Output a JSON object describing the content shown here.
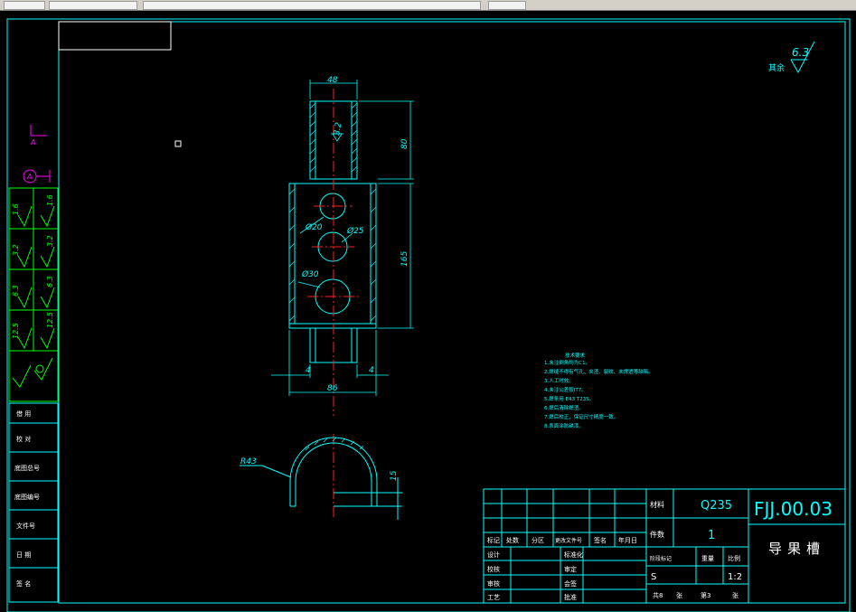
{
  "colors": {
    "background": "#000000",
    "border": "#00ffff",
    "outline": "#00ffff",
    "dimension": "#00ffff",
    "centerline": "#ff2020",
    "note_text": "#00ffff",
    "side_panel": "#00ff00",
    "datum_marker": "#ff00ff",
    "title_block_text": "#ffffff",
    "roughness": "#00ffff"
  },
  "dimensions": {
    "top_width": "48",
    "top_height": "80",
    "body_height": "165",
    "overall_width": "86",
    "left_offset": "4",
    "right_offset": "4",
    "hole_small": "Ø20",
    "hole_medium": "Ø25",
    "hole_large": "Ø30",
    "radius": "R43",
    "depth": "15",
    "roughness_local": "3.2",
    "roughness_corner": "6.3",
    "roughness_corner_note": "其余"
  },
  "datum": {
    "section_label": "A",
    "circle_label": "A"
  },
  "side_panel": {
    "roughness_values": [
      "1.6",
      "1.6",
      "3.2",
      "3.2",
      "6.3",
      "6.3",
      "12.5",
      "12.5"
    ],
    "rows": [
      "借 用",
      "校 对",
      "底图总号",
      "底图编号",
      "文件号",
      "日 期",
      "签 名"
    ]
  },
  "notes": {
    "title": "技术要求",
    "lines": [
      "1.未注倒角均为C1。",
      "2.焊缝不得有气孔、夹渣、裂纹、未焊透等缺陷。",
      "3.人工时效。",
      "4.未注公差按IT7。",
      "5.焊条用 E43 T235。",
      "6.焊后清除焊渣。",
      "7.焊后校正，保证尺寸精度一致。",
      "8.表面涂防锈漆。"
    ]
  },
  "title_block": {
    "material_label": "材料",
    "material_value": "Q235",
    "quantity_label": "件数",
    "quantity_value": "1",
    "drawing_number": "FJJ.00.03",
    "part_name": "导果槽",
    "stage_mark": "S",
    "scale_label": "比例",
    "scale_value": "1:2",
    "weight_label": "重量",
    "stage_label": "阶段标记",
    "sheet_total": "共8",
    "sheet_word_1": "张",
    "sheet_no": "第3",
    "sheet_word_2": "张",
    "revision_headers": [
      "标记",
      "处数",
      "分区",
      "更改文件号",
      "签名",
      "年月日"
    ],
    "role_rows": [
      {
        "left": "设计",
        "right": "标准化"
      },
      {
        "left": "校核",
        "right": "审定"
      },
      {
        "left": "审核",
        "right": "会签"
      },
      {
        "left": "工艺",
        "right": "批准"
      }
    ]
  }
}
